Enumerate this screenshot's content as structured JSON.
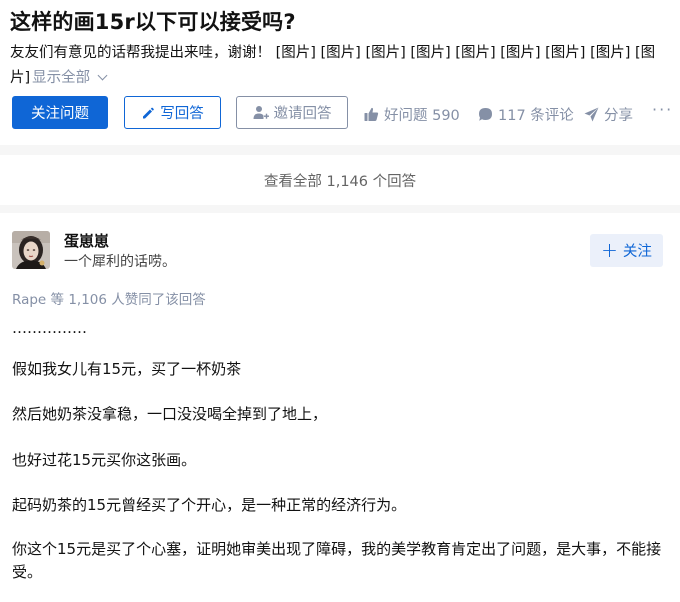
{
  "question": {
    "title": "这样的画15r以下可以接受吗?",
    "detail": "友友们有意见的话帮我提出来哇，谢谢！ [图片] [图片] [图片] [图片] [图片] [图片] [图片] [图片] [图片]",
    "show_all": "显示全部"
  },
  "actions": {
    "follow_question": "关注问题",
    "write_answer": "写回答",
    "invite_answer": "邀请回答",
    "good_question": "好问题 590",
    "comments": "117 条评论",
    "share": "分享",
    "more": "···"
  },
  "view_all": "查看全部 1,146 个回答",
  "answer": {
    "author_name": "蛋崽崽",
    "author_bio": "一个犀利的话唠。",
    "follow_label": "关注",
    "vote_summary": "Rape 等 1,106 人赞同了该回答",
    "paragraphs": [
      "……………",
      "假如我女儿有15元，买了一杯奶茶",
      "然后她奶茶没拿稳，一口没没喝全掉到了地上，",
      "也好过花15元买你这张画。",
      "起码奶茶的15元曾经买了个开心，是一种正常的经济行为。",
      "你这个15元是买了个心塞，证明她审美出现了障碍，我的美学教育肯定出了问题，是大事，不能接受。"
    ]
  },
  "colors": {
    "brand": "#0f66d6",
    "meta": "#8590a6",
    "page_bg": "#f6f6f6"
  }
}
